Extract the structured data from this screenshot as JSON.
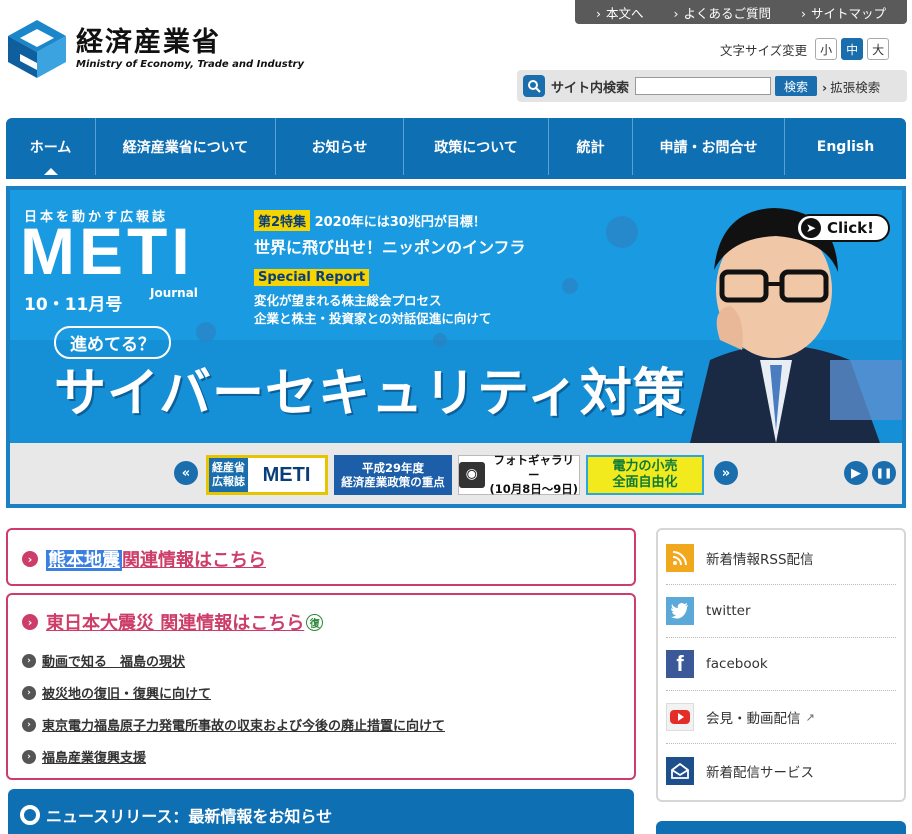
{
  "utility": {
    "links": [
      "本文へ",
      "よくあるご質問",
      "サイトマップ"
    ]
  },
  "logo": {
    "title": "経済産業省",
    "subtitle": "Ministry of Economy, Trade and Industry"
  },
  "fontsize": {
    "label": "文字サイズ変更",
    "small": "小",
    "medium": "中",
    "large": "大",
    "selected": "中"
  },
  "search": {
    "label": "サイト内検索",
    "value": "",
    "button": "検索",
    "advanced": "拡張検索"
  },
  "nav": {
    "items": [
      "ホーム",
      "経済産業省について",
      "お知らせ",
      "政策について",
      "統計",
      "申請・お問合せ",
      "English"
    ],
    "active": "ホーム"
  },
  "banner": {
    "magazine": "日本を動かす広報誌",
    "brand": "METI",
    "journal": "Journal",
    "issue": "10・11月号",
    "feature2_tag": "第2特集",
    "feature2_line1": "2020年には30兆円が目標！",
    "feature2_line2": "世界に飛び出せ！ニッポンのインフラ",
    "special_tag": "Special Report",
    "special_line1": "変化が望まれる株主総会プロセス",
    "special_line2": "企業と株主・投資家との対話促進に向けて",
    "bubble": "進めてる？",
    "headline": "サイバーセキュリティ対策",
    "click": "Click!"
  },
  "thumbs": {
    "meti_left_1": "経産省",
    "meti_left_2": "広報誌",
    "meti_right": "METI",
    "policy_1": "平成29年度",
    "policy_2": "経済産業政策の重点",
    "photo_1": "フォトギャラリー",
    "photo_2": "(10月8日～9日)",
    "power_1": "電力の小売",
    "power_2": "全面自由化"
  },
  "quake": {
    "kumamoto_hl": "熊本地震",
    "kumamoto_rest": "関連情報はこちら",
    "tohoku": "東日本大震災 関連情報はこちら",
    "fuku": "復",
    "links": [
      "動画で知る　福島の現状",
      "被災地の復旧・復興に向けて",
      "東京電力福島原子力発電所事故の収束および今後の廃止措置に向けて",
      "福島産業復興支援"
    ]
  },
  "news": {
    "title": "ニュースリリース：最新情報をお知らせ"
  },
  "sidebar": {
    "items": [
      {
        "label": "新着情報RSS配信",
        "icon": "rss-icon",
        "color": "#f2a81d"
      },
      {
        "label": "twitter",
        "icon": "twitter-icon",
        "color": "#5aa9d8"
      },
      {
        "label": "facebook",
        "icon": "facebook-icon",
        "color": "#3b5998"
      },
      {
        "label": "会見・動画配信",
        "icon": "youtube-icon",
        "color": "#e52d27"
      },
      {
        "label": "新着配信サービス",
        "icon": "mail-icon",
        "color": "#1d4f8a"
      }
    ]
  },
  "colors": {
    "primary": "#0f6fb3",
    "accent_pink": "#cc3d6a"
  }
}
